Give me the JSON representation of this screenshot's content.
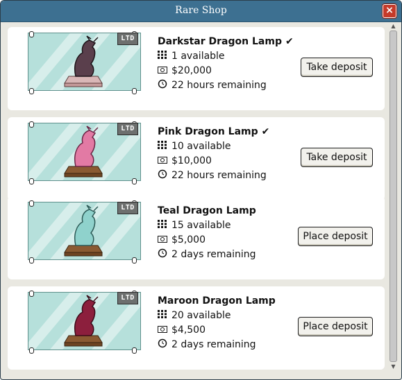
{
  "window": {
    "title": "Rare Shop",
    "close_label": "×"
  },
  "items": [
    {
      "name": "Darkstar Dragon Lamp",
      "checked": true,
      "available": "1 available",
      "price": "$20,000",
      "time": "22 hours remaining",
      "button": "Take deposit",
      "badge": "LTD",
      "color": "#5a3f4c",
      "accent": "#3a2833"
    },
    {
      "name": "Pink Dragon Lamp",
      "checked": true,
      "available": "10 available",
      "price": "$10,000",
      "time": "22 hours remaining",
      "button": "Take deposit",
      "badge": "LTD",
      "color": "#e27aa4",
      "accent": "#b24d7a"
    },
    {
      "name": "Teal Dragon Lamp",
      "checked": false,
      "available": "15 available",
      "price": "$5,000",
      "time": "2 days remaining",
      "button": "Place deposit",
      "badge": "LTD",
      "color": "#8fd2cc",
      "accent": "#4f9a94"
    },
    {
      "name": "Maroon Dragon Lamp",
      "checked": false,
      "available": "20 available",
      "price": "$4,500",
      "time": "2 days remaining",
      "button": "Place deposit",
      "badge": "LTD",
      "color": "#8c1f3d",
      "accent": "#5e1227"
    }
  ],
  "icons": {
    "check": "check-icon",
    "available": "grid-icon",
    "price": "money-icon",
    "time": "clock-icon"
  }
}
